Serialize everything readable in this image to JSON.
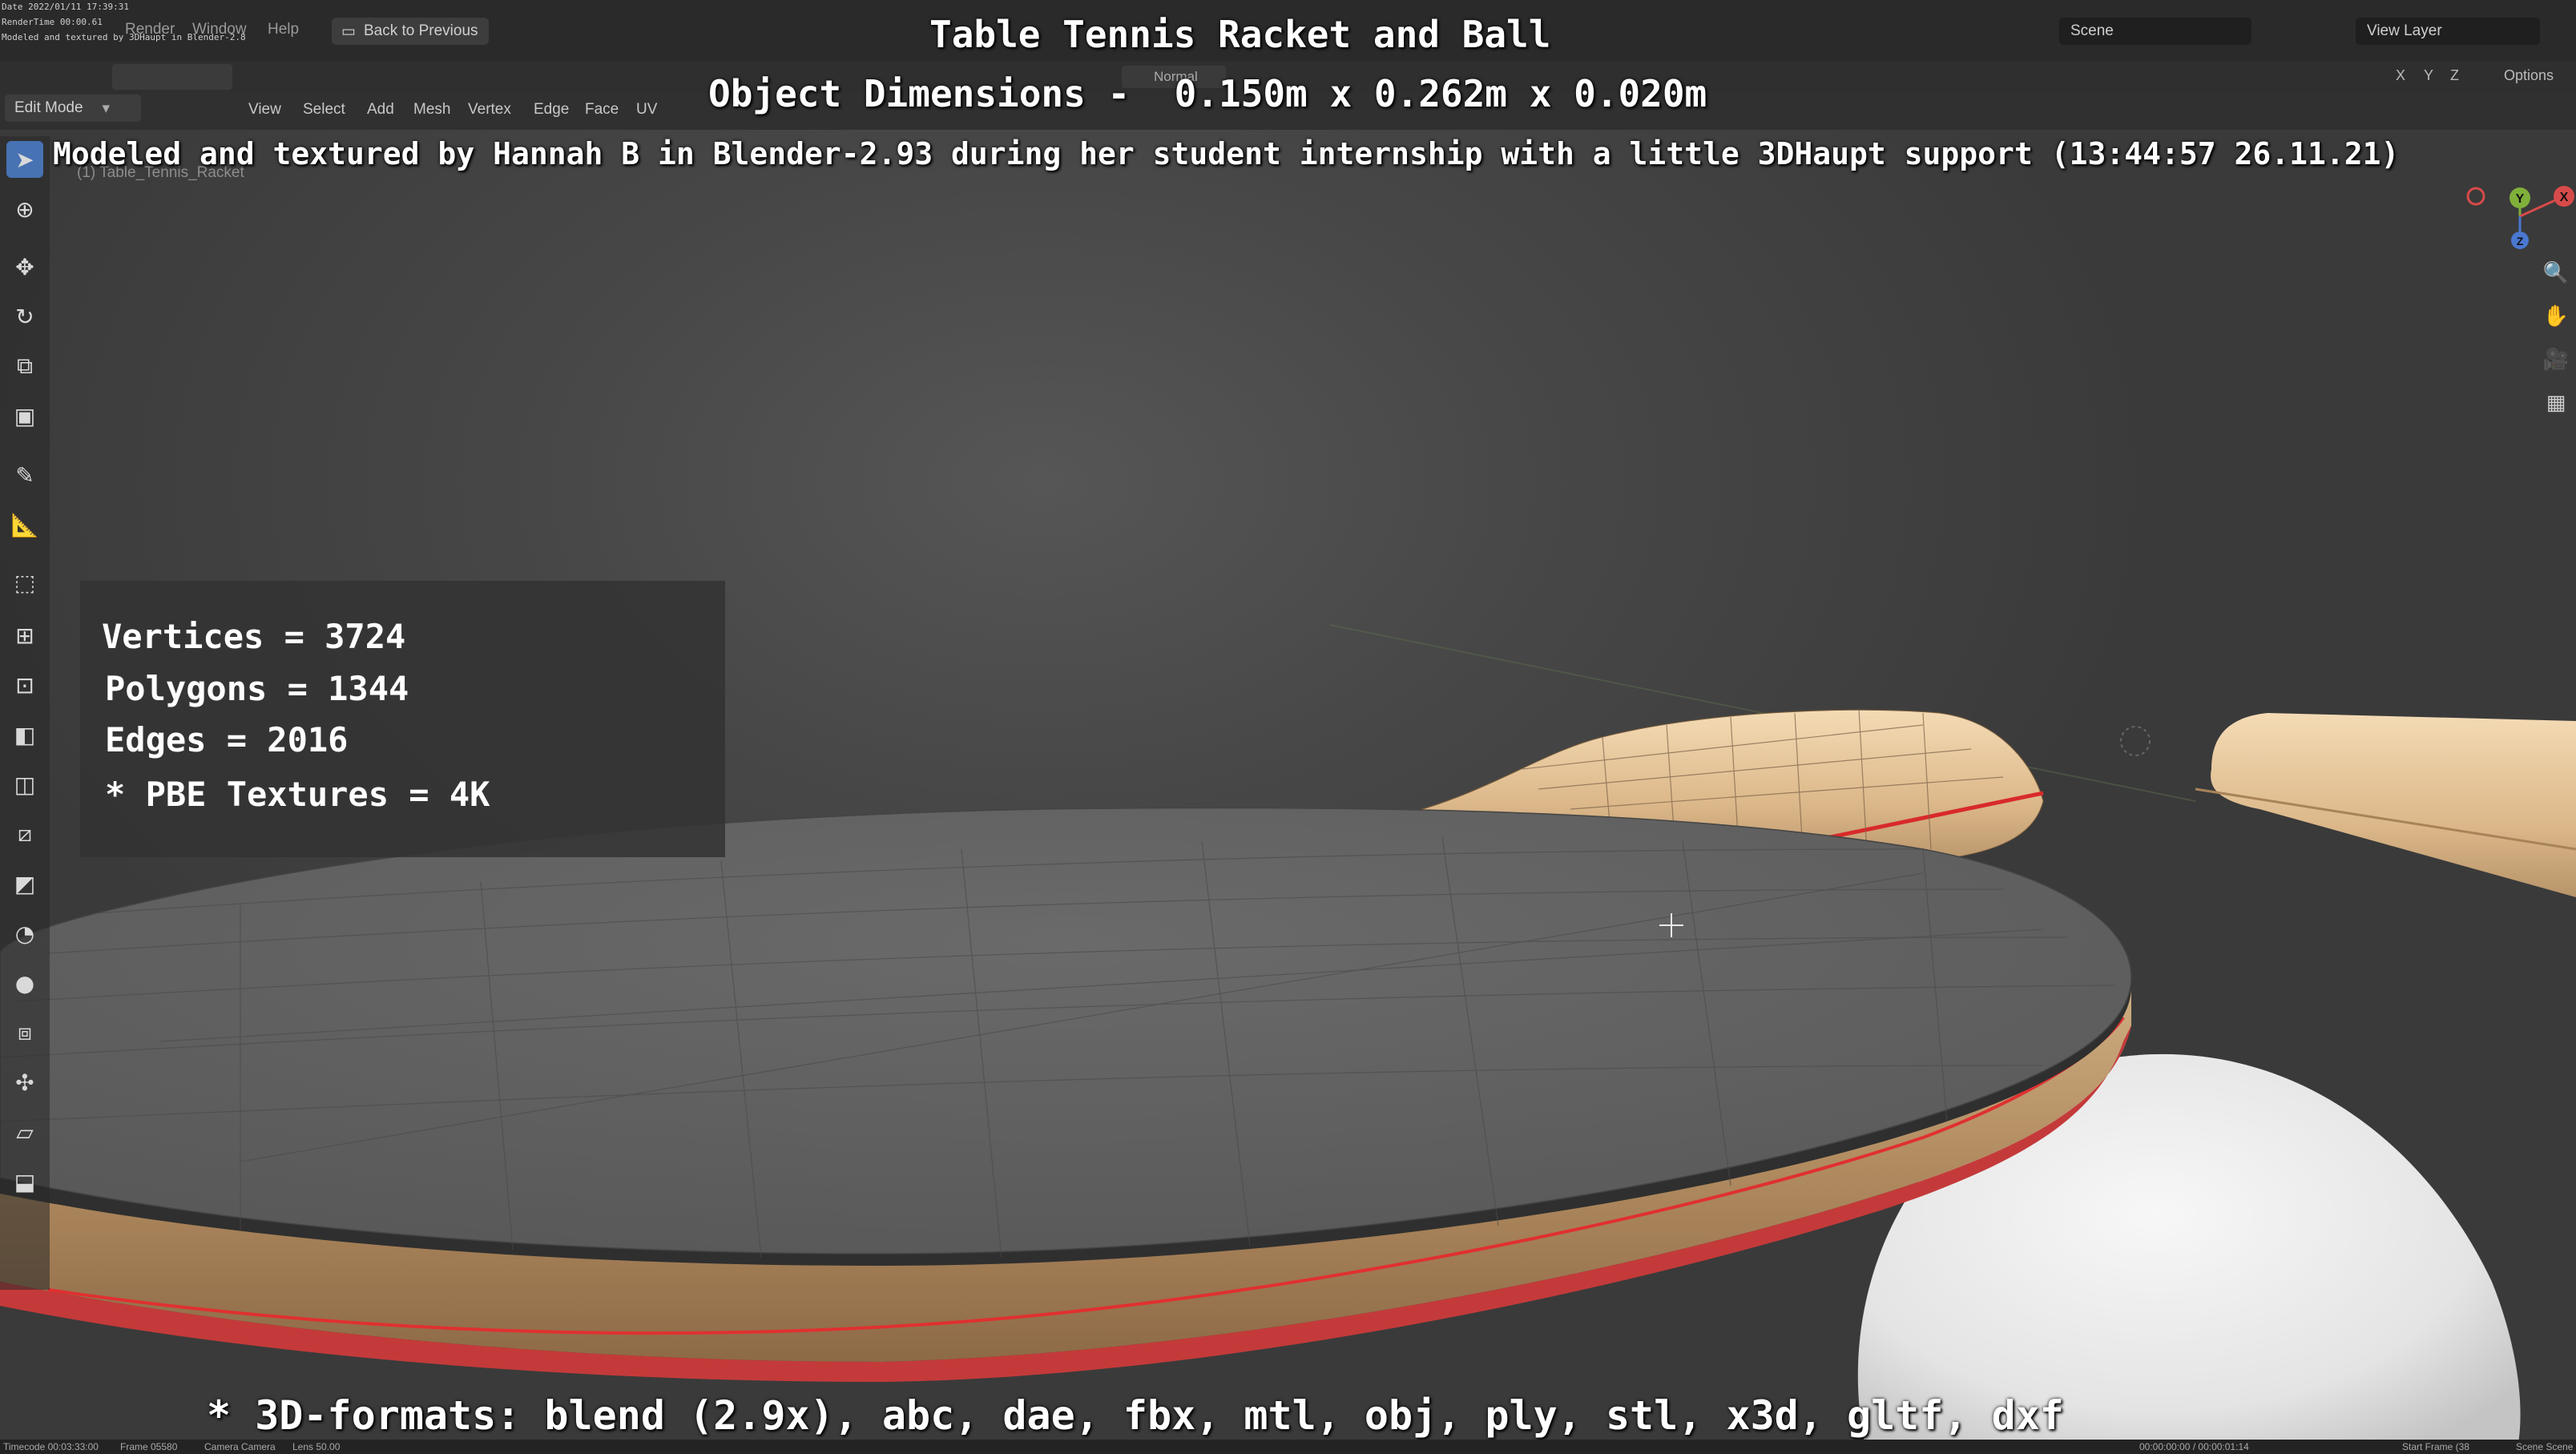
{
  "stamp": {
    "date": "Date 2022/01/11 17:39:31",
    "rendertime": "RenderTime 00:00.61",
    "note": "Modeled and textured by 3DHaupt in Blender-2.8"
  },
  "menu": {
    "items": [
      "Render",
      "Window",
      "Help"
    ],
    "back_button": "Back to Previous"
  },
  "scene_field": "Scene",
  "view_layer_field": "View Layer",
  "header": {
    "mode": "Edit Mode",
    "menus": [
      "View",
      "Select",
      "Add",
      "Mesh",
      "Vertex",
      "Edge",
      "Face",
      "UV"
    ],
    "orientation": "Normal",
    "options": "Options",
    "axes": [
      "X",
      "Y",
      "Z"
    ]
  },
  "overlay": {
    "title": "Table Tennis Racket and Ball",
    "dimensions": "Object Dimensions -  0.150m x 0.262m x 0.020m",
    "credit": "Modeled and textured by Hannah B in Blender-2.93 during her student internship with a little 3DHaupt support (13:44:57 26.11.21)",
    "formats": "* 3D-formats: blend (2.9x), abc, dae, fbx, mtl, obj, ply, stl, x3d, gltf, dxf"
  },
  "object_name": "(1) Table_Tennis_Racket",
  "stats": {
    "vertices": "Vertices = 3724",
    "polygons": "Polygons = 1344",
    "edges": "Edges = 2016",
    "textures": "* PBE Textures = 4K"
  },
  "gizmo": {
    "x": "X",
    "y": "Y",
    "z": "Z"
  },
  "status_bar": {
    "timecode": "Timecode 00:03:33:00",
    "frame": "Frame 05580",
    "camera": "Camera Camera",
    "lens": "Lens 50.00",
    "range": "00:00:00:00 / 00:00:01:14",
    "start": "Start Frame (38",
    "scene": "Scene Scene"
  },
  "colors": {
    "accent": "#4772b3",
    "wood": "#d8b78d",
    "rubber_edge": "#e03030",
    "blade_top": "#5f5f5f",
    "ball": "#e9e9e9"
  }
}
